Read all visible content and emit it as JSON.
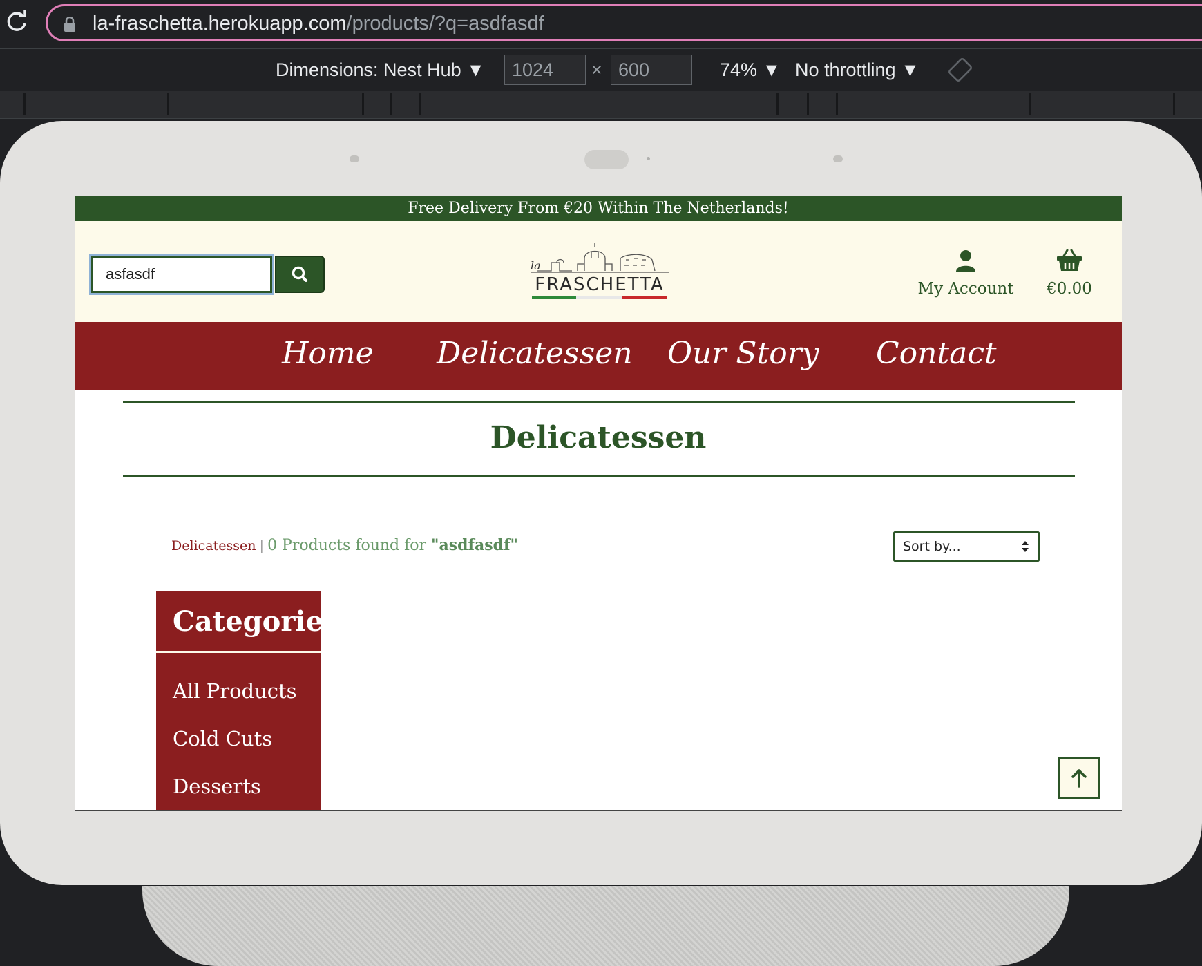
{
  "browser": {
    "url_host": "la-fraschetta.herokuapp.com",
    "url_path": "/products/?q=asdfasdf"
  },
  "devtools": {
    "dimensions_label": "Dimensions: Nest Hub ▼",
    "width_value": "1024",
    "times": "×",
    "height_value": "600",
    "zoom_label": "74% ▼",
    "throttling_label": "No throttling ▼"
  },
  "site": {
    "banner": "Free Delivery From €20 Within The Netherlands!",
    "search_value": "asfasdf",
    "logo_small": "la",
    "logo_text": "FRASCHETTA",
    "account_label": "My Account",
    "cart_total": "€0.00",
    "nav": [
      "Home",
      "Delicatessen",
      "Our Story",
      "Contact"
    ],
    "page_title": "Delicatessen",
    "breadcrumb": "Delicatessen",
    "breadcrumb_sep": "|",
    "found_prefix": "0 Products found for ",
    "found_query": "\"asdfasdf\"",
    "sort_label": "Sort by...",
    "categories_title": "Categories",
    "categories": [
      "All Products",
      "Cold Cuts",
      "Desserts"
    ]
  },
  "colors": {
    "green": "#2c5527",
    "red": "#8b1e1f",
    "cream": "#fdfaea",
    "focus_ring": "#e07fb8"
  }
}
